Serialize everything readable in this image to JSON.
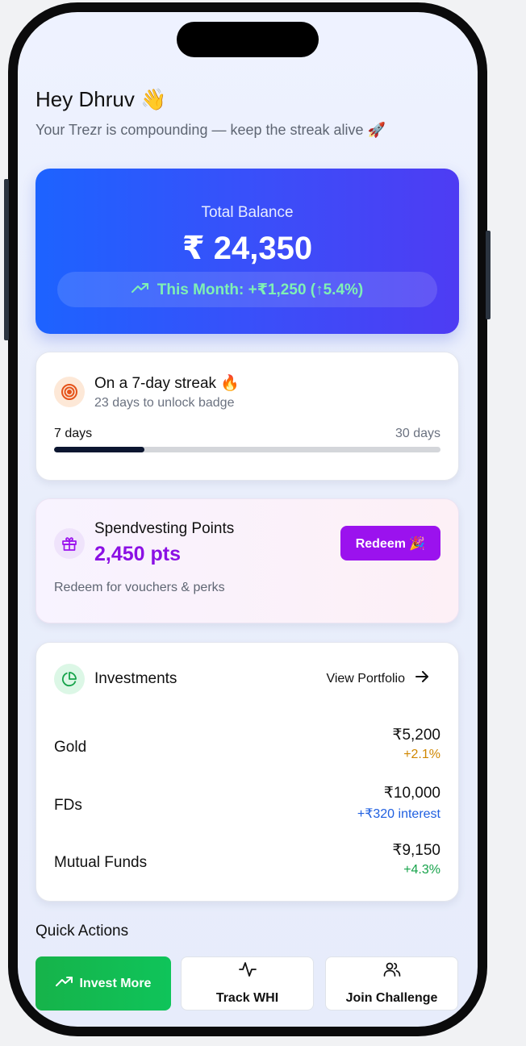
{
  "header": {
    "greeting": "Hey Dhruv 👋",
    "subtitle": "Your Trezr is compounding — keep the streak alive 🚀"
  },
  "balance": {
    "label": "Total Balance",
    "value": "₹ 24,350",
    "month_change": "This Month: +₹1,250 (↑5.4%)"
  },
  "streak": {
    "title": "On a 7-day streak 🔥",
    "subtitle": "23 days to unlock badge",
    "start_label": "7 days",
    "end_label": "30 days",
    "progress_fraction": 0.233
  },
  "points": {
    "title": "Spendvesting Points",
    "value": "2,450 pts",
    "subtitle": "Redeem for vouchers & perks",
    "redeem_label": "Redeem 🎉"
  },
  "investments": {
    "title": "Investments",
    "view_label": "View Portfolio",
    "items": [
      {
        "name": "Gold",
        "amount": "₹5,200",
        "change": "+2.1%",
        "change_color": "#d08700"
      },
      {
        "name": "FDs",
        "amount": "₹10,000",
        "change": "+₹320 interest",
        "change_color": "#1f5fe0"
      },
      {
        "name": "Mutual Funds",
        "amount": "₹9,150",
        "change": "+4.3%",
        "change_color": "#16a34a"
      }
    ]
  },
  "quick_actions": {
    "title": "Quick Actions",
    "invest_more": "Invest More",
    "track_whi": "Track WHI",
    "join_challenge": "Join Challenge"
  },
  "colors": {
    "accent_blue": "#1d63ff",
    "accent_purple": "#9b12ee",
    "accent_green": "#16b34a"
  }
}
